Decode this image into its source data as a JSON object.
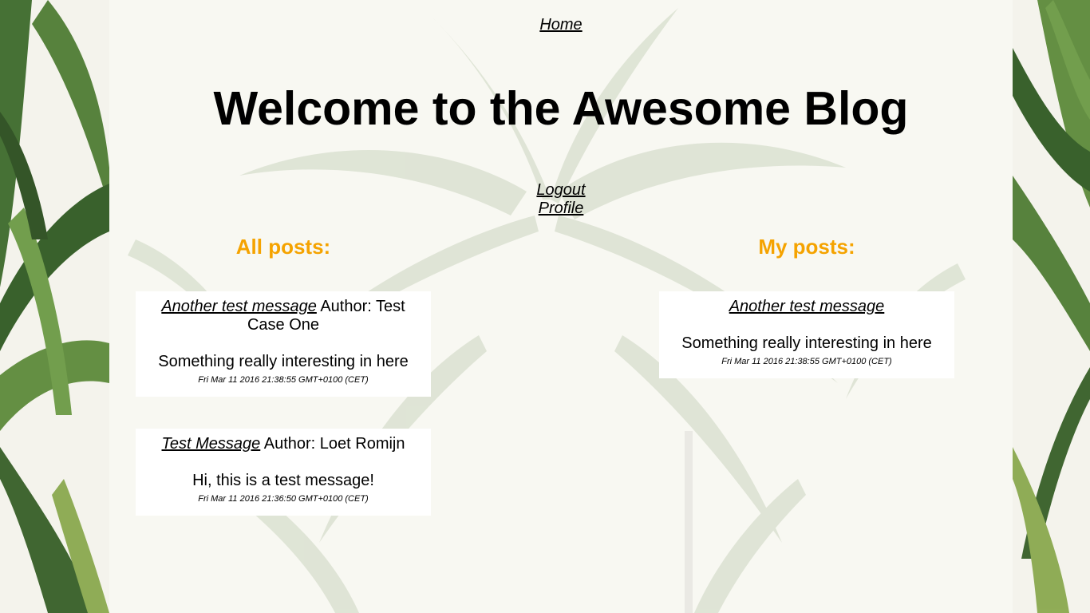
{
  "nav": {
    "home": "Home"
  },
  "header": {
    "title": "Welcome to the Awesome Blog"
  },
  "account": {
    "logout": "Logout",
    "profile": "Profile"
  },
  "all_posts": {
    "heading": "All posts:",
    "posts": [
      {
        "title": "Another test message",
        "author": "Author: Test Case One",
        "body": "Something really interesting in here",
        "date": "Fri Mar 11 2016 21:38:55 GMT+0100 (CET)"
      },
      {
        "title": "Test Message",
        "author": "Author: Loet Romijn",
        "body": "Hi, this is a test message!",
        "date": "Fri Mar 11 2016 21:36:50 GMT+0100 (CET)"
      }
    ]
  },
  "my_posts": {
    "heading": "My posts:",
    "posts": [
      {
        "title": "Another test message",
        "body": "Something really interesting in here",
        "date": "Fri Mar 11 2016 21:38:55 GMT+0100 (CET)"
      }
    ]
  },
  "colors": {
    "heading_accent": "#f5a300",
    "panel": "#ffffff",
    "text": "#000000"
  }
}
